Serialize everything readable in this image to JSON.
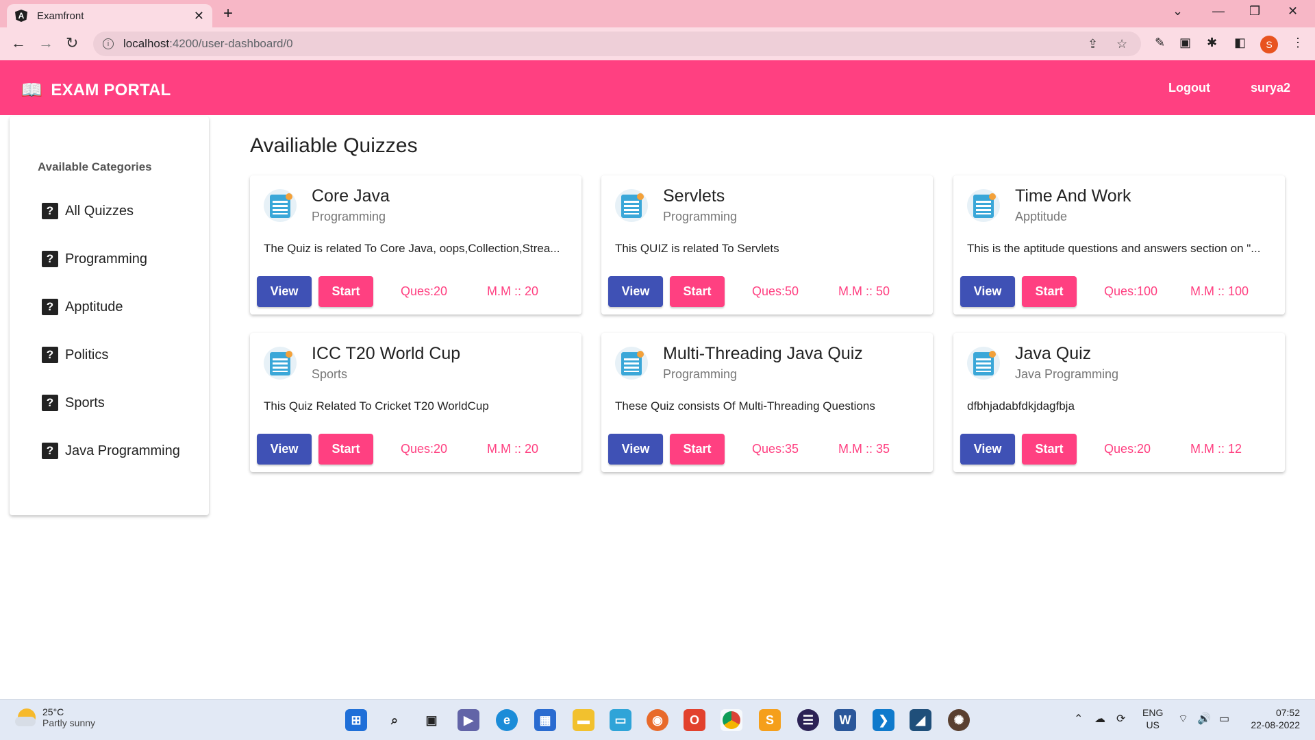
{
  "browser": {
    "tab_title": "Examfront",
    "url_host": "localhost",
    "url_path": ":4200/user-dashboard/0",
    "profile_initial": "S"
  },
  "navbar": {
    "brand": "EXAM PORTAL",
    "logout": "Logout",
    "username": "surya2"
  },
  "sidebar": {
    "heading": "Available Categories",
    "items": [
      {
        "label": "All Quizzes"
      },
      {
        "label": "Programming"
      },
      {
        "label": "Apptitude"
      },
      {
        "label": "Politics"
      },
      {
        "label": "Sports"
      },
      {
        "label": "Java Programming"
      }
    ]
  },
  "main": {
    "title": "Availiable Quizzes",
    "view_label": "View",
    "start_label": "Start",
    "quizzes": [
      {
        "title": "Core Java",
        "category": "Programming",
        "description": "The Quiz is related To Core Java, oops,Collection,Strea...",
        "questions": "Ques:20",
        "max_marks": "M.M :: 20"
      },
      {
        "title": "Servlets",
        "category": "Programming",
        "description": "This QUIZ is related To Servlets",
        "questions": "Ques:50",
        "max_marks": "M.M :: 50"
      },
      {
        "title": "Time And Work",
        "category": "Apptitude",
        "description": "This is the aptitude questions and answers section on \"...",
        "questions": "Ques:100",
        "max_marks": "M.M :: 100"
      },
      {
        "title": "ICC T20 World Cup",
        "category": "Sports",
        "description": "This Quiz Related To Cricket T20 WorldCup",
        "questions": "Ques:20",
        "max_marks": "M.M :: 20"
      },
      {
        "title": "Multi-Threading Java Quiz",
        "category": "Programming",
        "description": "These Quiz consists Of Multi-Threading Questions",
        "questions": "Ques:35",
        "max_marks": "M.M :: 35"
      },
      {
        "title": "Java Quiz",
        "category": "Java Programming",
        "description": "dfbhjadabfdkjdagfbja",
        "questions": "Ques:20",
        "max_marks": "M.M :: 12"
      }
    ]
  },
  "taskbar": {
    "temperature": "25°C",
    "condition": "Partly sunny",
    "lang_top": "ENG",
    "lang_bottom": "US",
    "time": "07:52",
    "date": "22-08-2022"
  },
  "colors": {
    "primary": "#3f51b5",
    "accent": "#ff4081"
  }
}
